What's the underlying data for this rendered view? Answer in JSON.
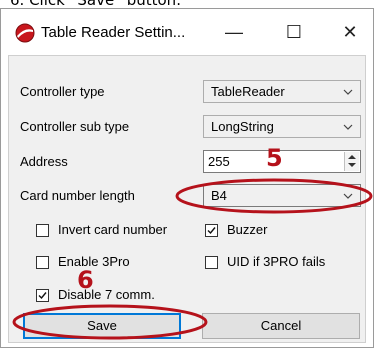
{
  "caption": "6. Click “Save” button.",
  "window": {
    "title": "Table Reader Settin...",
    "minimize_glyph": "—",
    "maximize_glyph": "☐",
    "close_glyph": "✕"
  },
  "fields": {
    "controller_type": {
      "label": "Controller type",
      "value": "TableReader"
    },
    "controller_sub_type": {
      "label": "Controller sub type",
      "value": "LongString"
    },
    "address": {
      "label": "Address",
      "value": "255"
    },
    "card_number_length": {
      "label": "Card number length",
      "value": "B4"
    }
  },
  "checkboxes": {
    "invert_card_number": {
      "label": "Invert card number",
      "checked": false
    },
    "buzzer": {
      "label": "Buzzer",
      "checked": true
    },
    "enable_3pro": {
      "label": "Enable 3Pro",
      "checked": false
    },
    "uid_if_3pro_fails": {
      "label": "UID if 3PRO fails",
      "checked": false
    },
    "disable_comm": {
      "label": "Disable 7 comm.",
      "checked": true
    }
  },
  "buttons": {
    "save": "Save",
    "cancel": "Cancel"
  },
  "annotations": {
    "step5": "5",
    "step6": "6"
  },
  "colors": {
    "annotation": "#b5121b",
    "focus": "#0078d7"
  }
}
